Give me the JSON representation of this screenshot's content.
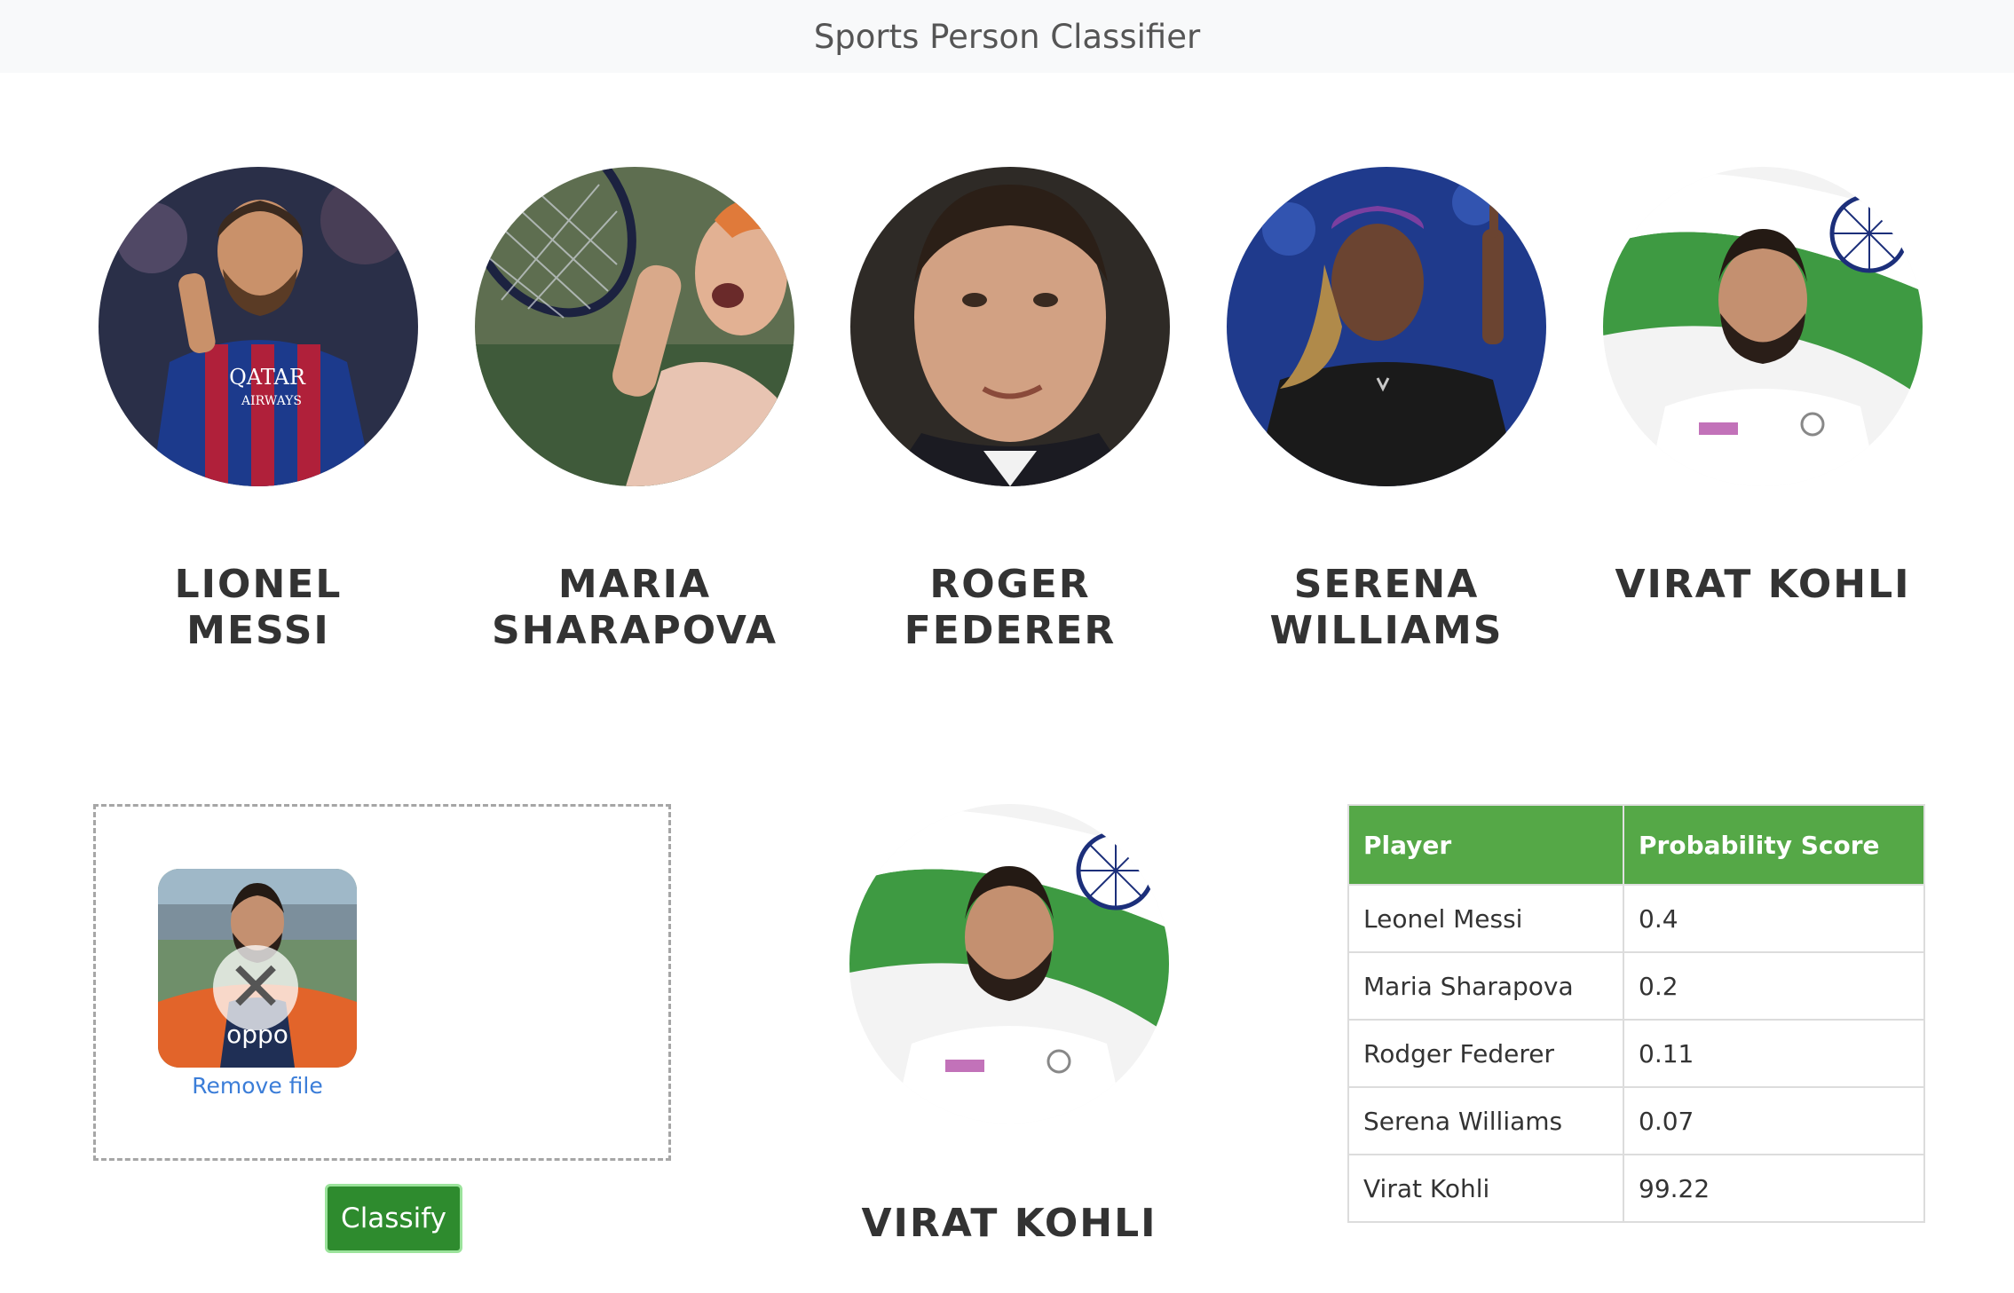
{
  "navbar": {
    "title": "Sports Person Classifier"
  },
  "players": [
    {
      "name": "LIONEL\nMESSI",
      "image": "messi-photo"
    },
    {
      "name": "MARIA\nSHARAPOVA",
      "image": "sharapova-photo"
    },
    {
      "name": "ROGER\nFEDERER",
      "image": "federer-photo"
    },
    {
      "name": "SERENA\nWILLIAMS",
      "image": "serena-photo"
    },
    {
      "name": "VIRAT KOHLI",
      "image": "kohli-photo"
    }
  ],
  "upload": {
    "remove_label": "Remove file",
    "remove_icon": "close-icon"
  },
  "classify_button": "Classify",
  "result": {
    "name": "VIRAT KOHLI"
  },
  "table": {
    "headers": [
      "Player",
      "Probability Score"
    ],
    "rows": [
      [
        "Leonel Messi",
        "0.4"
      ],
      [
        "Maria Sharapova",
        "0.2"
      ],
      [
        "Rodger Federer",
        "0.11"
      ],
      [
        "Serena Williams",
        "0.07"
      ],
      [
        "Virat Kohli",
        "99.22"
      ]
    ]
  },
  "colors": {
    "table_header": "#55a847",
    "button": "#2e8b2e",
    "link": "#3b7dd8"
  }
}
